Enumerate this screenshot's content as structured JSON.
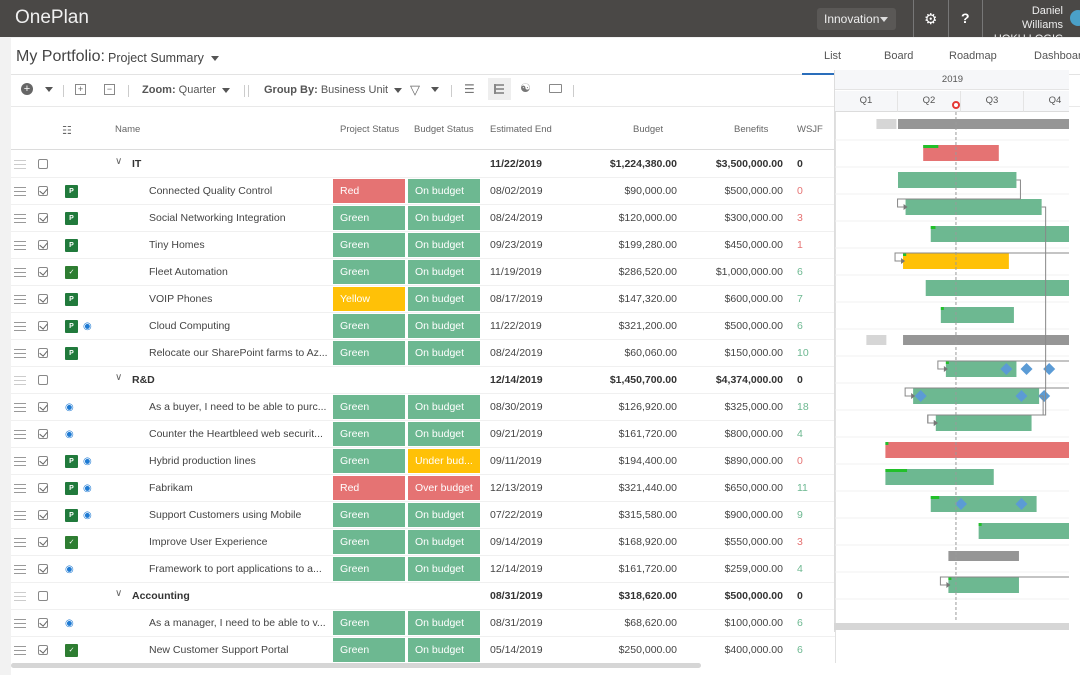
{
  "app": {
    "title": "OnePlan"
  },
  "header": {
    "workspace": "Innovation",
    "user_name": "Daniel Williams",
    "org": "HOKU LOGIC",
    "settings_icon": "gear-icon",
    "help_label": "?"
  },
  "page": {
    "title": "My Portfolio:",
    "view": "Project Summary"
  },
  "tabs": [
    {
      "label": "List",
      "active": true
    },
    {
      "label": "Board",
      "active": false
    },
    {
      "label": "Roadmap",
      "active": false
    },
    {
      "label": "Dashboard",
      "active": false
    }
  ],
  "toolbar": {
    "zoom_label": "Zoom:",
    "zoom_value": "Quarter",
    "group_label": "Group By:",
    "group_value": "Business Unit"
  },
  "columns": {
    "name": "Name",
    "project_status": "Project Status",
    "budget_status": "Budget Status",
    "estimated_end": "Estimated End",
    "budget": "Budget",
    "benefits": "Benefits",
    "wsjf": "WSJF"
  },
  "colors": {
    "green": "#6db891",
    "red": "#e57373",
    "yellow": "#ffc107",
    "wsjf_green": "#6db891",
    "wsjf_red": "#e57373",
    "accent": "#2a6ebb"
  },
  "timeline": {
    "year": "2019",
    "quarters": [
      "Q1",
      "Q2",
      "Q3",
      "Q4"
    ]
  },
  "rows": [
    {
      "type": "group",
      "name": "IT",
      "end": "11/22/2019",
      "budget": "$1,224,380.00",
      "benefits": "$3,500,000.00",
      "wsjf": "0"
    },
    {
      "type": "item",
      "name": "Connected Quality Control",
      "icons": [
        "project"
      ],
      "ps": "Red",
      "bs": "On budget",
      "end": "08/02/2019",
      "budget": "$90,000.00",
      "benefits": "$500,000.00",
      "wsjf": "0",
      "wsjf_color": "red"
    },
    {
      "type": "item",
      "name": "Social Networking Integration",
      "icons": [
        "project"
      ],
      "ps": "Green",
      "bs": "On budget",
      "end": "08/24/2019",
      "budget": "$120,000.00",
      "benefits": "$300,000.00",
      "wsjf": "3",
      "wsjf_color": "red"
    },
    {
      "type": "item",
      "name": "Tiny Homes",
      "icons": [
        "project"
      ],
      "ps": "Green",
      "bs": "On budget",
      "end": "09/23/2019",
      "budget": "$199,280.00",
      "benefits": "$450,000.00",
      "wsjf": "1",
      "wsjf_color": "red"
    },
    {
      "type": "item",
      "name": "Fleet Automation",
      "icons": [
        "team"
      ],
      "ps": "Green",
      "bs": "On budget",
      "end": "11/19/2019",
      "budget": "$286,520.00",
      "benefits": "$1,000,000.00",
      "wsjf": "6",
      "wsjf_color": "green"
    },
    {
      "type": "item",
      "name": "VOIP Phones",
      "icons": [
        "project"
      ],
      "ps": "Yellow",
      "bs": "On budget",
      "end": "08/17/2019",
      "budget": "$147,320.00",
      "benefits": "$600,000.00",
      "wsjf": "7",
      "wsjf_color": "green"
    },
    {
      "type": "item",
      "name": "Cloud Computing",
      "icons": [
        "project",
        "devops"
      ],
      "ps": "Green",
      "bs": "On budget",
      "end": "11/22/2019",
      "budget": "$321,200.00",
      "benefits": "$500,000.00",
      "wsjf": "6",
      "wsjf_color": "green"
    },
    {
      "type": "item",
      "name": "Relocate our SharePoint farms to Az...",
      "icons": [
        "project"
      ],
      "ps": "Green",
      "bs": "On budget",
      "end": "08/24/2019",
      "budget": "$60,060.00",
      "benefits": "$150,000.00",
      "wsjf": "10",
      "wsjf_color": "green"
    },
    {
      "type": "group",
      "name": "R&D",
      "end": "12/14/2019",
      "budget": "$1,450,700.00",
      "benefits": "$4,374,000.00",
      "wsjf": "0"
    },
    {
      "type": "item",
      "name": "As a buyer, I need to be able to purc...",
      "icons": [
        "devops"
      ],
      "ps": "Green",
      "bs": "On budget",
      "end": "08/30/2019",
      "budget": "$126,920.00",
      "benefits": "$325,000.00",
      "wsjf": "18",
      "wsjf_color": "green"
    },
    {
      "type": "item",
      "name": "Counter the Heartbleed web securit...",
      "icons": [
        "devops"
      ],
      "ps": "Green",
      "bs": "On budget",
      "end": "09/21/2019",
      "budget": "$161,720.00",
      "benefits": "$800,000.00",
      "wsjf": "4",
      "wsjf_color": "green"
    },
    {
      "type": "item",
      "name": "Hybrid production lines",
      "icons": [
        "project",
        "devops"
      ],
      "ps": "Green",
      "bs": "Under bud...",
      "bs_color": "Yellow",
      "end": "09/11/2019",
      "budget": "$194,400.00",
      "benefits": "$890,000.00",
      "wsjf": "0",
      "wsjf_color": "red"
    },
    {
      "type": "item",
      "name": "Fabrikam",
      "icons": [
        "project",
        "devops"
      ],
      "ps": "Red",
      "bs": "Over budget",
      "bs_color": "Red",
      "end": "12/13/2019",
      "budget": "$321,440.00",
      "benefits": "$650,000.00",
      "wsjf": "11",
      "wsjf_color": "green"
    },
    {
      "type": "item",
      "name": "Support Customers using Mobile",
      "icons": [
        "project",
        "devops"
      ],
      "ps": "Green",
      "bs": "On budget",
      "end": "07/22/2019",
      "budget": "$315,580.00",
      "benefits": "$900,000.00",
      "wsjf": "9",
      "wsjf_color": "green"
    },
    {
      "type": "item",
      "name": "Improve User Experience",
      "icons": [
        "team"
      ],
      "ps": "Green",
      "bs": "On budget",
      "end": "09/14/2019",
      "budget": "$168,920.00",
      "benefits": "$550,000.00",
      "wsjf": "3",
      "wsjf_color": "red"
    },
    {
      "type": "item",
      "name": "Framework to port applications to a...",
      "icons": [
        "devops"
      ],
      "ps": "Green",
      "bs": "On budget",
      "end": "12/14/2019",
      "budget": "$161,720.00",
      "benefits": "$259,000.00",
      "wsjf": "4",
      "wsjf_color": "green"
    },
    {
      "type": "group",
      "name": "Accounting",
      "end": "08/31/2019",
      "budget": "$318,620.00",
      "benefits": "$500,000.00",
      "wsjf": "0"
    },
    {
      "type": "item",
      "name": "As a manager, I need to be able to v...",
      "icons": [
        "devops"
      ],
      "ps": "Green",
      "bs": "On budget",
      "end": "08/31/2019",
      "budget": "$68,620.00",
      "benefits": "$100,000.00",
      "wsjf": "6",
      "wsjf_color": "green"
    },
    {
      "type": "item",
      "name": "New Customer Support Portal",
      "icons": [
        "team"
      ],
      "ps": "Green",
      "bs": "On budget",
      "end": "05/14/2019",
      "budget": "$250,000.00",
      "benefits": "$400,000.00",
      "wsjf": "6",
      "wsjf_color": "green"
    }
  ],
  "gantt_bars": [
    {
      "row": 0,
      "kind": "summary",
      "start": 0.25,
      "end": 0.98,
      "lead": 0.22
    },
    {
      "row": 1,
      "kind": "bar",
      "color": "red",
      "start": 0.35,
      "end": 0.65,
      "progress": 0.2
    },
    {
      "row": 2,
      "kind": "bar",
      "color": "green",
      "start": 0.25,
      "end": 0.72
    },
    {
      "row": 3,
      "kind": "bar",
      "color": "green",
      "start": 0.28,
      "end": 0.82
    },
    {
      "row": 4,
      "kind": "bar",
      "color": "green",
      "start": 0.38,
      "end": 1.0,
      "progress": 0.03
    },
    {
      "row": 5,
      "kind": "bar",
      "color": "yellow",
      "start": 0.27,
      "end": 0.69,
      "progress": 0.03
    },
    {
      "row": 6,
      "kind": "bar",
      "color": "green",
      "start": 0.36,
      "end": 1.0
    },
    {
      "row": 7,
      "kind": "bar",
      "color": "green",
      "start": 0.42,
      "end": 0.71,
      "progress": 0.03
    },
    {
      "row": 8,
      "kind": "summary",
      "start": 0.27,
      "end": 1.0,
      "lead": 0.18
    },
    {
      "row": 9,
      "kind": "bar",
      "color": "green",
      "start": 0.44,
      "end": 0.72,
      "progress": 0.03,
      "milestones": [
        0.68,
        0.76,
        0.85
      ]
    },
    {
      "row": 10,
      "kind": "bar",
      "color": "green",
      "start": 0.31,
      "end": 0.81,
      "milestones": [
        0.34,
        0.74,
        0.83
      ]
    },
    {
      "row": 11,
      "kind": "bar",
      "color": "green",
      "start": 0.4,
      "end": 0.78
    },
    {
      "row": 12,
      "kind": "bar",
      "color": "red",
      "start": 0.2,
      "end": 1.0,
      "progress": 0.01
    },
    {
      "row": 13,
      "kind": "bar",
      "color": "green",
      "start": 0.2,
      "end": 0.63,
      "progress": 0.2
    },
    {
      "row": 14,
      "kind": "bar",
      "color": "green",
      "start": 0.38,
      "end": 0.8,
      "progress": 0.08,
      "milestones": [
        0.5,
        0.74
      ]
    },
    {
      "row": 15,
      "kind": "bar",
      "color": "green",
      "start": 0.57,
      "end": 1.0,
      "progress": 0.02
    },
    {
      "row": 16,
      "kind": "summary",
      "start": 0.45,
      "end": 0.73
    },
    {
      "row": 17,
      "kind": "bar",
      "color": "green",
      "start": 0.45,
      "end": 0.73,
      "progress": 0.01
    }
  ],
  "today_fraction": 0.48
}
